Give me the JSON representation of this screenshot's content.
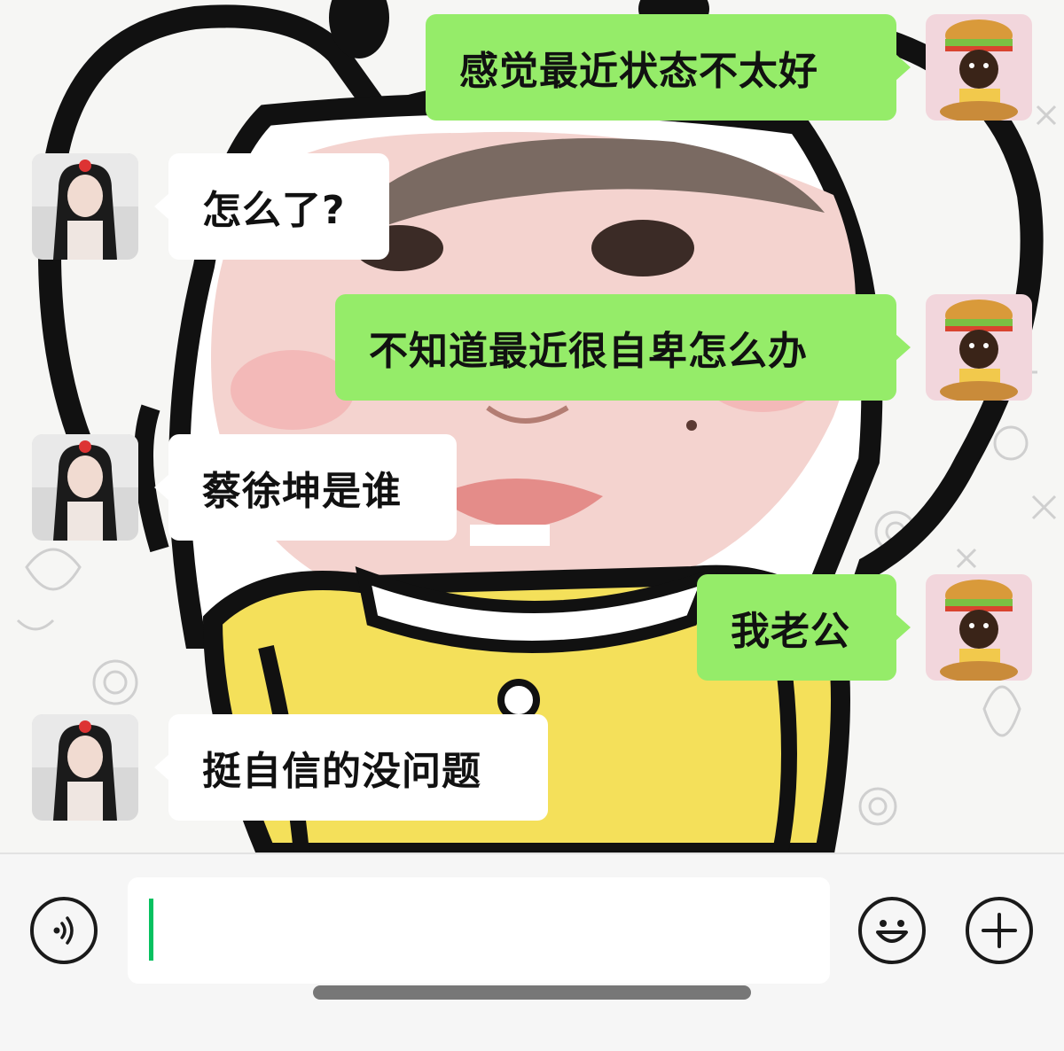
{
  "messages": [
    {
      "side": "out",
      "text": "感觉最近状态不太好"
    },
    {
      "side": "in",
      "text": "怎么了?"
    },
    {
      "side": "out",
      "text": "不知道最近很自卑怎么办"
    },
    {
      "side": "in",
      "text": "蔡徐坤是谁"
    },
    {
      "side": "out",
      "text": "我老公"
    },
    {
      "side": "in",
      "text": "挺自信的没问题"
    }
  ],
  "input_bar": {
    "voice_icon": "voice-icon",
    "emoji_icon": "emoji-icon",
    "plus_icon": "plus-icon",
    "input_value": ""
  },
  "colors": {
    "outgoing_bubble": "#95ec69",
    "incoming_bubble": "#ffffff",
    "caret": "#07c160"
  }
}
